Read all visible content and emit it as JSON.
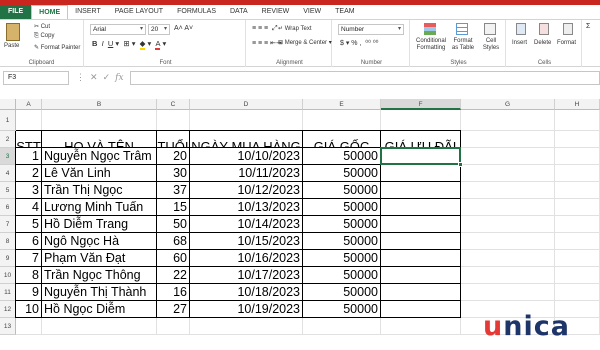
{
  "ribbon_tabs": [
    "FILE",
    "HOME",
    "INSERT",
    "PAGE LAYOUT",
    "FORMULAS",
    "DATA",
    "REVIEW",
    "VIEW",
    "TEAM"
  ],
  "clipboard": {
    "cut": "Cut",
    "copy": "Copy",
    "format_painter": "Format Painter",
    "paste": "Paste",
    "label": "Clipboard"
  },
  "font": {
    "name": "Arial",
    "size": "20",
    "label": "Font"
  },
  "alignment": {
    "wrap": "Wrap Text",
    "merge": "Merge & Center",
    "label": "Alignment"
  },
  "number": {
    "format": "Number",
    "label": "Number"
  },
  "styles": {
    "cond": "Conditional Formatting",
    "table": "Format as Table",
    "cell": "Cell Styles",
    "label": "Styles"
  },
  "cells": {
    "insert": "Insert",
    "delete": "Delete",
    "format": "Format",
    "label": "Cells"
  },
  "namebox": "F3",
  "fx": "fx",
  "columns": [
    "A",
    "B",
    "C",
    "D",
    "E",
    "F",
    "G",
    "H"
  ],
  "selected_column": "F",
  "selected_row": "3",
  "headers": [
    "STT",
    "HỌ VÀ TÊN",
    "TUỔI",
    "NGÀY MUA HÀNG",
    "GIÁ GỐC",
    "GIÁ ƯU ĐÃI"
  ],
  "rows": [
    [
      "1",
      "Nguyễn Ngọc Trâm",
      "20",
      "10/10/2023",
      "50000",
      ""
    ],
    [
      "2",
      "Lê Văn Linh",
      "30",
      "10/11/2023",
      "50000",
      ""
    ],
    [
      "3",
      "Trần Thị Ngọc",
      "37",
      "10/12/2023",
      "50000",
      ""
    ],
    [
      "4",
      "Lương Minh Tuấn",
      "15",
      "10/13/2023",
      "50000",
      ""
    ],
    [
      "5",
      "Hồ Diễm Trang",
      "50",
      "10/14/2023",
      "50000",
      ""
    ],
    [
      "6",
      "Ngô Ngọc Hà",
      "68",
      "10/15/2023",
      "50000",
      ""
    ],
    [
      "7",
      "Phạm Văn Đạt",
      "60",
      "10/16/2023",
      "50000",
      ""
    ],
    [
      "8",
      "Trần Ngọc Thông",
      "22",
      "10/17/2023",
      "50000",
      ""
    ],
    [
      "9",
      "Nguyễn Thị Thành",
      "16",
      "10/18/2023",
      "50000",
      ""
    ],
    [
      "10",
      "Hồ Ngọc Diễm",
      "27",
      "10/19/2023",
      "50000",
      ""
    ]
  ],
  "logo": {
    "u": "u",
    "rest": "nica"
  }
}
